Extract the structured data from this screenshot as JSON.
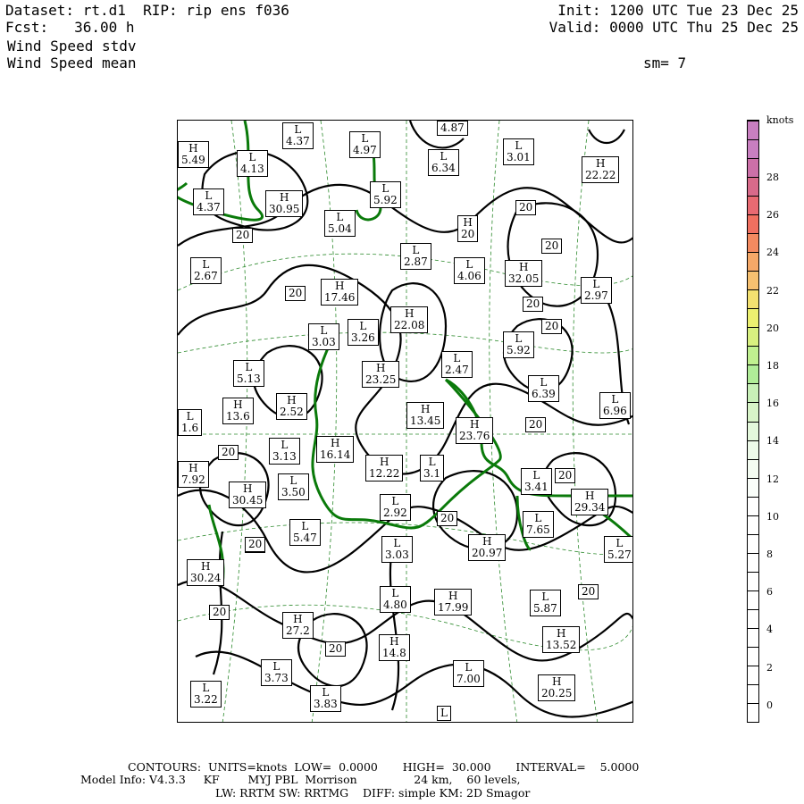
{
  "header": {
    "line1_left": "Dataset: rt.d1  RIP: rip ens f036",
    "line2_left": "Fcst:   36.00 h",
    "line3_left": "Wind Speed stdv",
    "line4_left": "Wind Speed mean",
    "line1_right": "Init: 1200 UTC Tue 23 Dec 25",
    "line2_right": "Valid: 0000 UTC Thu 25 Dec 25",
    "sm": "sm= 7"
  },
  "map": {
    "labels": [
      {
        "t": "L",
        "v": "4.37"
      },
      {
        "t": "L",
        "v": "4.97"
      },
      {
        "t": "",
        "v": "4.87"
      },
      {
        "t": "L",
        "v": "3.01"
      },
      {
        "t": "H",
        "v": "5.49"
      },
      {
        "t": "L",
        "v": "4.13"
      },
      {
        "t": "L",
        "v": "6.34"
      },
      {
        "t": "H",
        "v": "22.22"
      },
      {
        "t": "L",
        "v": "4.37"
      },
      {
        "t": "L",
        "v": "5.92"
      },
      {
        "t": "H",
        "v": "30.95"
      },
      {
        "t": "L",
        "v": "5.04"
      },
      {
        "t": "H",
        "v": "20"
      },
      {
        "t": "",
        "v": "20"
      },
      {
        "t": "",
        "v": "20"
      },
      {
        "t": "",
        "v": "20"
      },
      {
        "t": "L",
        "v": "2.67"
      },
      {
        "t": "L",
        "v": "2.87"
      },
      {
        "t": "L",
        "v": "4.06"
      },
      {
        "t": "H",
        "v": "32.05"
      },
      {
        "t": "L",
        "v": "2.97"
      },
      {
        "t": "",
        "v": "20"
      },
      {
        "t": "H",
        "v": "17.46"
      },
      {
        "t": "",
        "v": "20"
      },
      {
        "t": "H",
        "v": "22.08"
      },
      {
        "t": "L",
        "v": "3.03"
      },
      {
        "t": "L",
        "v": "3.26"
      },
      {
        "t": "L",
        "v": "5.92"
      },
      {
        "t": "",
        "v": "20"
      },
      {
        "t": "L",
        "v": "5.13"
      },
      {
        "t": "H",
        "v": "23.25"
      },
      {
        "t": "L",
        "v": "2.47"
      },
      {
        "t": "L",
        "v": "6.39"
      },
      {
        "t": "H",
        "v": "13.6"
      },
      {
        "t": "H",
        "v": "2.52"
      },
      {
        "t": "H",
        "v": "13.45"
      },
      {
        "t": "L",
        "v": "6.96"
      },
      {
        "t": "L",
        "v": "1.6"
      },
      {
        "t": "H",
        "v": "23.76"
      },
      {
        "t": "",
        "v": "20"
      },
      {
        "t": "L",
        "v": "3.13"
      },
      {
        "t": "H",
        "v": "16.14"
      },
      {
        "t": "H",
        "v": "12.22"
      },
      {
        "t": "L",
        "v": "3.1"
      },
      {
        "t": "",
        "v": "20"
      },
      {
        "t": "",
        "v": "20"
      },
      {
        "t": "H",
        "v": "7.92"
      },
      {
        "t": "L",
        "v": "3.41"
      },
      {
        "t": "",
        "v": "20"
      },
      {
        "t": "H",
        "v": "30.45"
      },
      {
        "t": "L",
        "v": "3.50"
      },
      {
        "t": "L",
        "v": "2.92"
      },
      {
        "t": "L",
        "v": "7.65"
      },
      {
        "t": "H",
        "v": "29.34"
      },
      {
        "t": "L",
        "v": "5.47"
      },
      {
        "t": "",
        "v": "20"
      },
      {
        "t": "H",
        "v": "20.97"
      },
      {
        "t": "L",
        "v": "5.27"
      },
      {
        "t": "",
        "v": "20"
      },
      {
        "t": "L",
        "v": "3.03"
      },
      {
        "t": "H",
        "v": "30.24"
      },
      {
        "t": "L",
        "v": "4.80"
      },
      {
        "t": "H",
        "v": "17.99"
      },
      {
        "t": "L",
        "v": "5.87"
      },
      {
        "t": "",
        "v": "20"
      },
      {
        "t": "",
        "v": "20"
      },
      {
        "t": "H",
        "v": "27.2"
      },
      {
        "t": "H",
        "v": "14.8"
      },
      {
        "t": "H",
        "v": "13.52"
      },
      {
        "t": "",
        "v": "20"
      },
      {
        "t": "L",
        "v": "3.73"
      },
      {
        "t": "L",
        "v": "7.00"
      },
      {
        "t": "H",
        "v": "20.25"
      },
      {
        "t": "L",
        "v": "3.22"
      },
      {
        "t": "L",
        "v": "3.83"
      },
      {
        "t": "L",
        "v": ""
      }
    ]
  },
  "colorbar": {
    "unit": "knots",
    "ticks": [
      "28",
      "26",
      "24",
      "22",
      "20",
      "18",
      "16",
      "14",
      "12",
      "10",
      "8",
      "6",
      "4",
      "2",
      "0"
    ],
    "colors": [
      "#c87fc0",
      "#c87fc0",
      "#cc70a8",
      "#d86a8a",
      "#e86a72",
      "#f07060",
      "#f38a60",
      "#f5a868",
      "#f6c070",
      "#f3e070",
      "#ecf070",
      "#d8f080",
      "#c0f090",
      "#b0ec98",
      "#c8f0b8",
      "#d8f4c8",
      "#e4f8dc",
      "#eefaea",
      "#f4fcf2",
      "#fafefa",
      "#ffffff",
      "#ffffff",
      "#ffffff",
      "#ffffff",
      "#ffffff",
      "#ffffff",
      "#ffffff",
      "#ffffff",
      "#ffffff",
      "#ffffff",
      "#ffffff",
      "#ffffff"
    ]
  },
  "footer": {
    "line1": "CONTOURS:  UNITS=knots  LOW=  0.0000       HIGH=  30.000       INTERVAL=    5.0000",
    "line2": "Model Info: V4.3.3     KF        MYJ PBL  Morrison                24 km,    60 levels,",
    "line3": "LW: RRTM SW: RRTMG    DIFF: simple KM: 2D Smagor"
  },
  "colors": {
    "contour": "#000000",
    "coast": "#0a7a0a",
    "grid": "#2e8b2e"
  }
}
